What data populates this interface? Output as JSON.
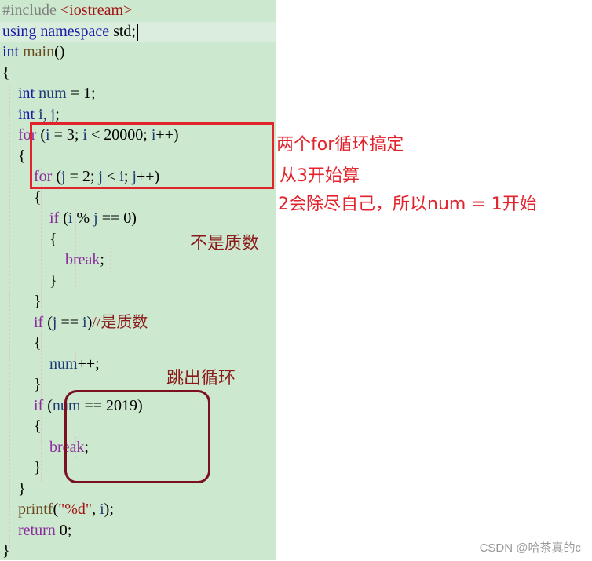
{
  "code_lines": [
    {
      "tokens": [
        {
          "t": "#include ",
          "c": "pp"
        },
        {
          "t": "<iostream>",
          "c": "inc"
        }
      ]
    },
    {
      "tokens": [
        {
          "t": "using",
          "c": "kw"
        },
        {
          "t": " ",
          "c": ""
        },
        {
          "t": "namespace",
          "c": "kw"
        },
        {
          "t": " std;",
          "c": ""
        }
      ]
    },
    {
      "tokens": [
        {
          "t": "int",
          "c": "ty"
        },
        {
          "t": " ",
          "c": ""
        },
        {
          "t": "main",
          "c": "fn"
        },
        {
          "t": "()",
          "c": ""
        }
      ]
    },
    {
      "tokens": [
        {
          "t": "{",
          "c": ""
        }
      ]
    },
    {
      "tokens": [
        {
          "t": "    ",
          "c": ""
        },
        {
          "t": "int",
          "c": "ty"
        },
        {
          "t": " ",
          "c": ""
        },
        {
          "t": "num",
          "c": "var"
        },
        {
          "t": " = 1;",
          "c": ""
        }
      ]
    },
    {
      "tokens": [
        {
          "t": "    ",
          "c": ""
        },
        {
          "t": "int",
          "c": "ty"
        },
        {
          "t": " ",
          "c": ""
        },
        {
          "t": "i, j",
          "c": "var"
        },
        {
          "t": ";",
          "c": ""
        }
      ]
    },
    {
      "tokens": [
        {
          "t": "    ",
          "c": ""
        },
        {
          "t": "for",
          "c": "kw2"
        },
        {
          "t": " (",
          "c": ""
        },
        {
          "t": "i",
          "c": "var"
        },
        {
          "t": " = 3; ",
          "c": ""
        },
        {
          "t": "i",
          "c": "var"
        },
        {
          "t": " < 20000; ",
          "c": ""
        },
        {
          "t": "i",
          "c": "var"
        },
        {
          "t": "++)",
          "c": ""
        }
      ]
    },
    {
      "tokens": [
        {
          "t": "    {",
          "c": ""
        }
      ]
    },
    {
      "tokens": [
        {
          "t": "        ",
          "c": ""
        },
        {
          "t": "for",
          "c": "kw2"
        },
        {
          "t": " (",
          "c": ""
        },
        {
          "t": "j",
          "c": "var"
        },
        {
          "t": " = 2; ",
          "c": ""
        },
        {
          "t": "j",
          "c": "var"
        },
        {
          "t": " < ",
          "c": ""
        },
        {
          "t": "i",
          "c": "var"
        },
        {
          "t": "; ",
          "c": ""
        },
        {
          "t": "j",
          "c": "var"
        },
        {
          "t": "++)",
          "c": ""
        }
      ]
    },
    {
      "tokens": [
        {
          "t": "        {",
          "c": ""
        }
      ]
    },
    {
      "tokens": [
        {
          "t": "            ",
          "c": ""
        },
        {
          "t": "if",
          "c": "kw2"
        },
        {
          "t": " (",
          "c": ""
        },
        {
          "t": "i",
          "c": "var"
        },
        {
          "t": " % ",
          "c": ""
        },
        {
          "t": "j",
          "c": "var"
        },
        {
          "t": " == 0)",
          "c": ""
        }
      ]
    },
    {
      "tokens": [
        {
          "t": "            {",
          "c": ""
        }
      ]
    },
    {
      "tokens": [
        {
          "t": "                ",
          "c": ""
        },
        {
          "t": "break",
          "c": "kw2"
        },
        {
          "t": ";",
          "c": ""
        }
      ]
    },
    {
      "tokens": [
        {
          "t": "            }",
          "c": ""
        }
      ]
    },
    {
      "tokens": [
        {
          "t": "        }",
          "c": ""
        }
      ]
    },
    {
      "tokens": [
        {
          "t": "        ",
          "c": ""
        },
        {
          "t": "if",
          "c": "kw2"
        },
        {
          "t": " (",
          "c": ""
        },
        {
          "t": "j",
          "c": "var"
        },
        {
          "t": " == ",
          "c": ""
        },
        {
          "t": "i",
          "c": "var"
        },
        {
          "t": ")",
          "c": ""
        },
        {
          "t": "//是质数",
          "c": "cmt"
        }
      ]
    },
    {
      "tokens": [
        {
          "t": "        {",
          "c": ""
        }
      ]
    },
    {
      "tokens": [
        {
          "t": "            ",
          "c": ""
        },
        {
          "t": "num",
          "c": "var"
        },
        {
          "t": "++;",
          "c": ""
        }
      ]
    },
    {
      "tokens": [
        {
          "t": "        }",
          "c": ""
        }
      ]
    },
    {
      "tokens": [
        {
          "t": "        ",
          "c": ""
        },
        {
          "t": "if",
          "c": "kw2"
        },
        {
          "t": " (",
          "c": ""
        },
        {
          "t": "num",
          "c": "var"
        },
        {
          "t": " == 2019)",
          "c": ""
        }
      ]
    },
    {
      "tokens": [
        {
          "t": "        {",
          "c": ""
        }
      ]
    },
    {
      "tokens": [
        {
          "t": "            ",
          "c": ""
        },
        {
          "t": "break",
          "c": "kw2"
        },
        {
          "t": ";",
          "c": ""
        }
      ]
    },
    {
      "tokens": [
        {
          "t": "        }",
          "c": ""
        }
      ]
    },
    {
      "tokens": [
        {
          "t": "    }",
          "c": ""
        }
      ]
    },
    {
      "tokens": [
        {
          "t": "    ",
          "c": ""
        },
        {
          "t": "printf",
          "c": "fn"
        },
        {
          "t": "(",
          "c": ""
        },
        {
          "t": "\"%d\"",
          "c": "str"
        },
        {
          "t": ", ",
          "c": ""
        },
        {
          "t": "i",
          "c": "var"
        },
        {
          "t": ");",
          "c": ""
        }
      ]
    },
    {
      "tokens": [
        {
          "t": "    ",
          "c": ""
        },
        {
          "t": "return",
          "c": "kw2"
        },
        {
          "t": " 0;",
          "c": ""
        }
      ]
    },
    {
      "tokens": [
        {
          "t": "}",
          "c": ""
        }
      ]
    }
  ],
  "annotations": {
    "two_for_loops": "两个for循环搞定",
    "start_from_3": "从3开始算",
    "num_starts_1": "2会除尽自己，所以num = 1开始",
    "not_prime": "不是质数",
    "break_loop": "跳出循环"
  },
  "watermark": "CSDN @哈茶真的c",
  "colors": {
    "editor_bg": "#cce8cf",
    "annotation_red": "#e3232c",
    "annotation_dark": "#8b1a1a"
  }
}
